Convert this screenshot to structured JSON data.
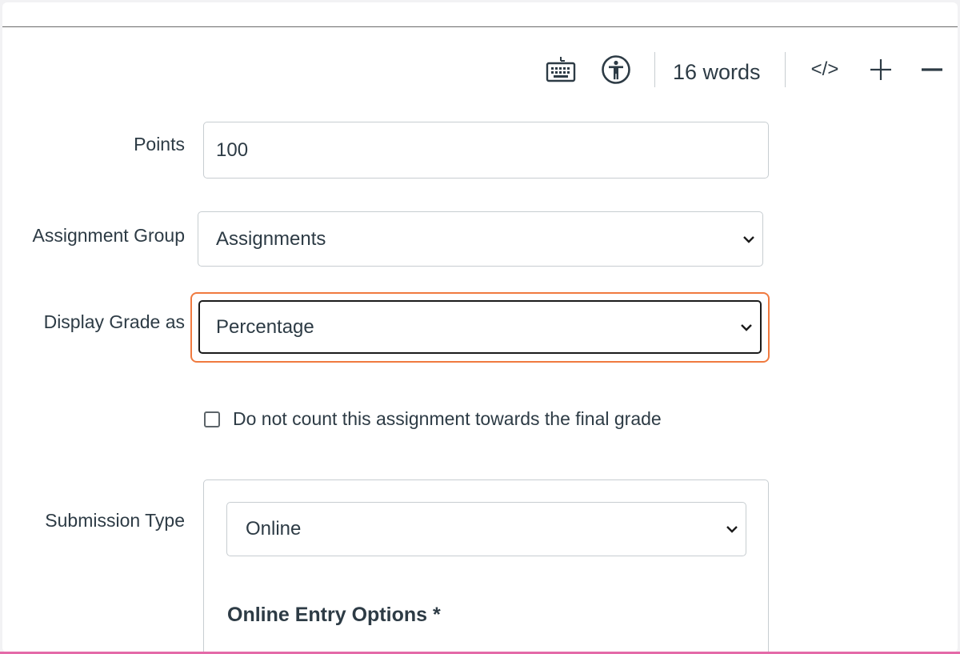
{
  "toolbar": {
    "icons": [
      "keyboard-icon",
      "accessibility-icon",
      "html-editor-icon",
      "plus-icon",
      "minus-icon"
    ],
    "word_count": "16 words",
    "html_toggle_label": "</>"
  },
  "form": {
    "points": {
      "label": "Points",
      "value": "100"
    },
    "assignment_group": {
      "label": "Assignment Group",
      "selected": "Assignments"
    },
    "display_grade": {
      "label": "Display Grade as",
      "selected": "Percentage"
    },
    "omit_from_final": {
      "label": "Do not count this assignment towards the final grade",
      "checked": false
    },
    "submission_type": {
      "label": "Submission Type",
      "selected": "Online",
      "online_entry_options_title": "Online Entry Options *"
    }
  },
  "colors": {
    "focus_highlight": "#f07a3f",
    "text": "#2d3b45",
    "border": "#c7cdd1"
  }
}
